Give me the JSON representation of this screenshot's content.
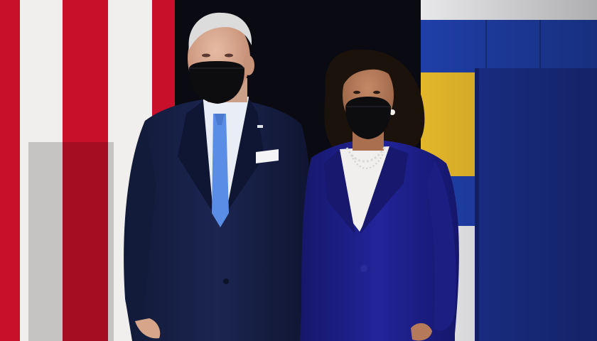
{
  "scene": {
    "subjects": [
      "person-left",
      "person-right"
    ],
    "colors": {
      "flag_red": "#c9102a",
      "flag_white": "#ece9e6",
      "curtain": "#0a0b12",
      "wall_blue": "#1f3fa8",
      "wall_blue_dark": "#1a2f8a",
      "wall_yellow": "#e4b72a",
      "wall_white": "#e8e8ea",
      "suit_navy": "#172045",
      "suit_blue": "#20228a",
      "tie_blue": "#5a8ee6",
      "mask": "#0d0d10",
      "skin_light": "#d9a98f",
      "skin_medium": "#b57a5a",
      "hair_white": "#dcdcdc",
      "hair_dark": "#1c120c"
    }
  }
}
